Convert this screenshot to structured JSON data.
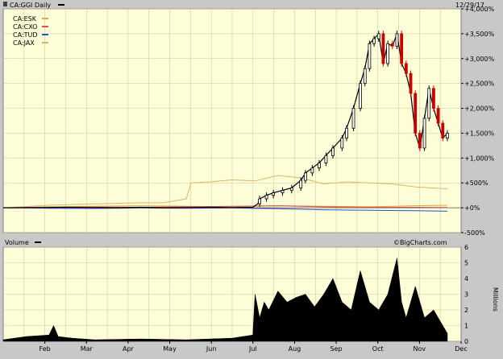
{
  "chart_data": {
    "type": "line",
    "header": {
      "title": "CA:GGI Daily",
      "date": "12/29/17",
      "watermark": "©BigCharts.com"
    },
    "colors": {
      "background": "#fdfdd8",
      "grid": "#c9c99a",
      "candle_up": "#000000",
      "candle_down": "#c80000",
      "volume": "#000000",
      "frame": "#808080",
      "chrome": "#c8c8c8"
    },
    "x_axis": {
      "tick_labels": [
        "Feb",
        "Mar",
        "Apr",
        "May",
        "Jun",
        "Jul",
        "Aug",
        "Sep",
        "Oct",
        "Nov",
        "Dec"
      ],
      "grid_count": 22
    },
    "price_panel": {
      "ylim": [
        -500,
        4000
      ],
      "yticks": [
        -500,
        0,
        500,
        1000,
        1500,
        2000,
        2500,
        3000,
        3500,
        4000
      ],
      "ytick_labels": [
        "-500%",
        "+0%",
        "+500%",
        "+1,000%",
        "+1,500%",
        "+2,000%",
        "+2,500%",
        "+3,000%",
        "+3,500%",
        "+4,000%"
      ],
      "legend": {
        "placement": "top-left",
        "entries": [
          {
            "name": "CA:ESK",
            "color": "#e8a040"
          },
          {
            "name": "CA:CXO",
            "color": "#d85050"
          },
          {
            "name": "CA:TUD",
            "color": "#2850d0"
          },
          {
            "name": "CA:JAX",
            "color": "#d8b868"
          }
        ]
      },
      "primary_series": {
        "name": "CA:GGI",
        "x": [
          0,
          0.08,
          0.14,
          0.2,
          0.25,
          0.3,
          0.35,
          0.4,
          0.45,
          0.5,
          0.545,
          0.556,
          0.56,
          0.575,
          0.59,
          0.61,
          0.63,
          0.65,
          0.66,
          0.675,
          0.69,
          0.705,
          0.72,
          0.74,
          0.75,
          0.765,
          0.78,
          0.79,
          0.8,
          0.81,
          0.82,
          0.83,
          0.84,
          0.85,
          0.86,
          0.87,
          0.88,
          0.89,
          0.9,
          0.91,
          0.92,
          0.93,
          0.94,
          0.95,
          0.96,
          0.97
        ],
        "values": [
          0,
          5,
          10,
          5,
          0,
          10,
          0,
          5,
          10,
          5,
          10,
          80,
          180,
          250,
          300,
          350,
          400,
          550,
          700,
          800,
          900,
          1050,
          1200,
          1400,
          1600,
          2000,
          2500,
          2800,
          3300,
          3400,
          3500,
          2900,
          3300,
          3250,
          3500,
          2900,
          2700,
          2300,
          1500,
          1200,
          1800,
          2400,
          2000,
          1700,
          1400,
          1500
        ]
      },
      "comparison_series": [
        {
          "name": "CA:JAX",
          "color": "#d8b868",
          "x": [
            0,
            0.1,
            0.2,
            0.3,
            0.35,
            0.4,
            0.41,
            0.45,
            0.5,
            0.55,
            0.6,
            0.65,
            0.7,
            0.75,
            0.8,
            0.85,
            0.9,
            0.97
          ],
          "values": [
            0,
            50,
            80,
            100,
            100,
            180,
            500,
            520,
            560,
            540,
            650,
            600,
            480,
            520,
            500,
            480,
            420,
            380
          ]
        },
        {
          "name": "CA:ESK",
          "color": "#e8a040",
          "x": [
            0,
            0.1,
            0.2,
            0.3,
            0.4,
            0.5,
            0.6,
            0.7,
            0.8,
            0.9,
            0.97
          ],
          "values": [
            0,
            20,
            30,
            40,
            30,
            20,
            40,
            30,
            20,
            40,
            50
          ]
        },
        {
          "name": "CA:CXO",
          "color": "#d85050",
          "x": [
            0,
            0.1,
            0.2,
            0.3,
            0.4,
            0.5,
            0.6,
            0.7,
            0.8,
            0.9,
            0.97
          ],
          "values": [
            0,
            10,
            15,
            10,
            20,
            30,
            40,
            20,
            10,
            10,
            5
          ]
        },
        {
          "name": "CA:TUD",
          "color": "#2850d0",
          "x": [
            0,
            0.1,
            0.2,
            0.3,
            0.4,
            0.5,
            0.6,
            0.7,
            0.8,
            0.9,
            0.97
          ],
          "values": [
            0,
            -10,
            -15,
            -5,
            -10,
            -5,
            -20,
            -40,
            -50,
            -60,
            -70
          ]
        }
      ]
    },
    "volume_panel": {
      "label": "Volume",
      "unit": "Millions",
      "ylim": [
        0,
        6
      ],
      "yticks": [
        0,
        1,
        2,
        3,
        4,
        5,
        6
      ],
      "ytick_labels": [
        "0",
        "1",
        "2",
        "3",
        "4",
        "5",
        "6"
      ],
      "x": [
        0,
        0.05,
        0.1,
        0.11,
        0.12,
        0.15,
        0.2,
        0.3,
        0.4,
        0.5,
        0.545,
        0.55,
        0.56,
        0.57,
        0.58,
        0.6,
        0.62,
        0.64,
        0.66,
        0.68,
        0.7,
        0.72,
        0.74,
        0.76,
        0.78,
        0.8,
        0.82,
        0.84,
        0.86,
        0.87,
        0.88,
        0.9,
        0.92,
        0.94,
        0.96,
        0.97
      ],
      "values": [
        0.1,
        0.3,
        0.4,
        1.0,
        0.3,
        0.2,
        0.1,
        0.15,
        0.1,
        0.2,
        0.4,
        3.0,
        1.5,
        2.5,
        2.0,
        3.2,
        2.5,
        2.8,
        3.0,
        2.2,
        3.0,
        4.0,
        2.5,
        2.0,
        4.5,
        2.5,
        2.0,
        3.0,
        5.3,
        2.5,
        1.5,
        3.5,
        1.5,
        2.0,
        1.0,
        0.5
      ]
    }
  }
}
